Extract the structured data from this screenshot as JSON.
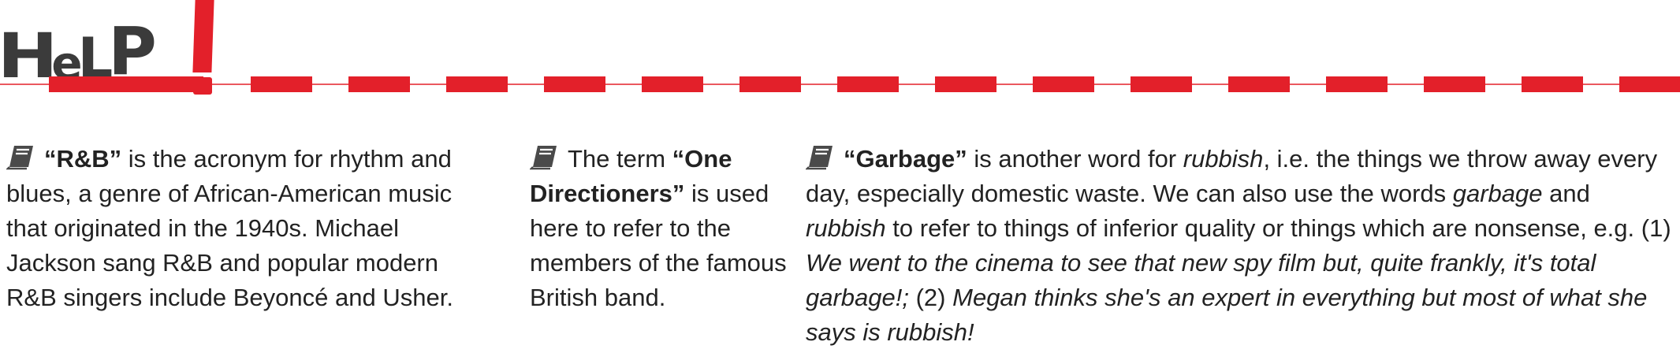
{
  "header": {
    "title_letters": [
      "H",
      "e",
      "L",
      "P"
    ],
    "exclamation": "!",
    "accent_color": "#e3202a",
    "title_color": "#3b3b3b"
  },
  "notes": [
    {
      "icon": "book-icon",
      "term": "“R&B”",
      "text": " is the acronym for rhythm and blues, a genre of African-American music that originated in the 1940s. Michael Jackson sang R&B and popular modern R&B singers include Beyoncé and Usher."
    },
    {
      "icon": "book-icon",
      "lead": "The term ",
      "term": "“One Directioners”",
      "text": " is used here to refer to the members of the famous British band."
    },
    {
      "icon": "book-icon",
      "term": "“Garbage”",
      "t1": " is another word for ",
      "i1": "rubbish",
      "t2": ", i.e. the things we throw away every day, especially domestic waste. We can also use the words ",
      "i2": "garbage",
      "t3": " and ",
      "i3": "rubbish",
      "t4": " to refer to things of inferior quality or things which are nonsense, e.g. (1) ",
      "ex1": "We went to the cinema to see that new spy film but, quite frankly, it's total garbage!;",
      "t5": " (2) ",
      "ex2": "Megan thinks she's an expert in everything but most of what she says is rubbish!"
    }
  ]
}
